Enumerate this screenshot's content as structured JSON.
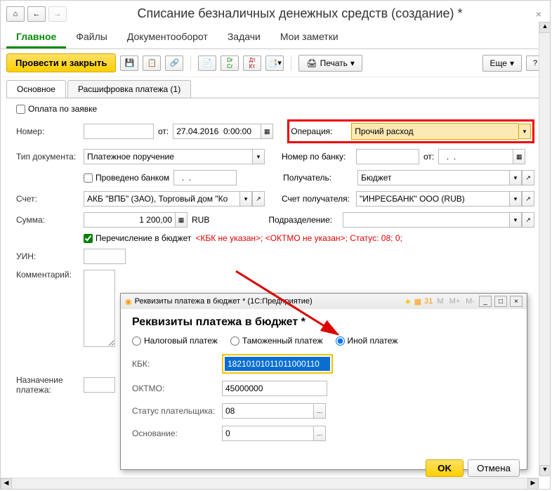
{
  "title": "Списание безналичных денежных средств (создание) *",
  "tabs": [
    "Главное",
    "Файлы",
    "Документооборот",
    "Задачи",
    "Мои заметки"
  ],
  "toolbar": {
    "submit": "Провести и закрыть",
    "print": "Печать",
    "more": "Еще",
    "help": "?"
  },
  "subtabs": [
    "Основное",
    "Расшифровка платежа (1)"
  ],
  "form": {
    "pay_by_request": "Оплата по заявке",
    "number_label": "Номер:",
    "number": "",
    "from_label": "от:",
    "date": "27.04.2016  0:00:00",
    "operation_label": "Операция:",
    "operation": "Прочий расход",
    "doctype_label": "Тип документа:",
    "doctype": "Платежное поручение",
    "bank_num_label": "Номер по банку:",
    "bank_num": "",
    "bank_from": "от:",
    "bank_date": "  .  .  ",
    "processed": "Проведено банком",
    "processed_date": "  .  .  ",
    "recipient_label": "Получатель:",
    "recipient": "Бюджет",
    "account_label": "Счет:",
    "account": "АКБ \"ВПБ\" (ЗАО), Торговый дом \"Ко",
    "rec_account_label": "Счет получателя:",
    "rec_account": "\"ИНРЕСБАНК\" ООО (RUB)",
    "sum_label": "Сумма:",
    "sum": "1 200,00",
    "currency": "RUB",
    "division_label": "Подразделение:",
    "division": "",
    "budget_transfer": "Перечисление в бюджет",
    "budget_warning": "<КБК не указан>; <ОКТМО не указан>; Статус: 08; 0;",
    "uin_label": "УИН:",
    "uin": "",
    "comment_label": "Комментарий:",
    "purpose_label": "Назначение платежа:"
  },
  "dialog": {
    "titlebar": "Реквизиты платежа в бюджет *  (1С:Предприятие)",
    "header": "Реквизиты платежа в бюджет *",
    "radios": [
      "Налоговый платеж",
      "Таможенный платеж",
      "Иной платеж"
    ],
    "kbk_label": "КБК:",
    "kbk": "18210101011011000110",
    "oktmo_label": "ОКТМО:",
    "oktmo": "45000000",
    "status_label": "Статус плательщика:",
    "status": "08",
    "basis_label": "Основание:",
    "basis": "0",
    "ok": "OK",
    "cancel": "Отмена",
    "m_buttons": [
      "M",
      "M+",
      "M-"
    ]
  }
}
